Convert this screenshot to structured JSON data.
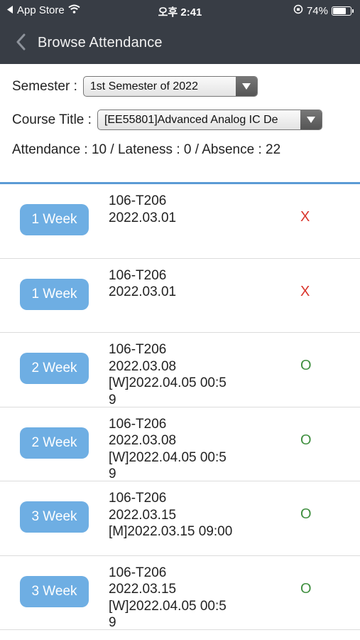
{
  "status_bar": {
    "back_app": "App Store",
    "time": "오후 2:41",
    "battery": "74%",
    "battery_level": 0.74
  },
  "nav": {
    "title": "Browse Attendance"
  },
  "filters": {
    "semester_label": "Semester :",
    "semester_value": "1st Semester of 2022",
    "course_label": "Course Title :",
    "course_value": "[EE55801]Advanced Analog IC De"
  },
  "summary": "Attendance : 10 / Lateness : 0 / Absence : 22",
  "records": [
    {
      "week": "1 Week",
      "room": "106-T206",
      "date": "2022.03.01",
      "detail_1": "",
      "detail_2": "",
      "mark": "X"
    },
    {
      "week": "1 Week",
      "room": "106-T206",
      "date": "2022.03.01",
      "detail_1": "",
      "detail_2": "",
      "mark": "X"
    },
    {
      "week": "2 Week",
      "room": "106-T206",
      "date": "2022.03.08",
      "detail_1": "[W]2022.04.05 00:5",
      "detail_2": "9",
      "mark": "O"
    },
    {
      "week": "2 Week",
      "room": "106-T206",
      "date": "2022.03.08",
      "detail_1": "[W]2022.04.05 00:5",
      "detail_2": "9",
      "mark": "O"
    },
    {
      "week": "3 Week",
      "room": "106-T206",
      "date": "2022.03.15",
      "detail_1": "[M]2022.03.15 09:00",
      "detail_2": "",
      "mark": "O"
    },
    {
      "week": "3 Week",
      "room": "106-T206",
      "date": "2022.03.15",
      "detail_1": "[W]2022.04.05 00:5",
      "detail_2": "9",
      "mark": "O"
    }
  ],
  "colors": {
    "header_bg": "#383d45",
    "week_button": "#6eaee3",
    "absent_mark": "#d9342b",
    "present_mark": "#3f8f3f",
    "list_divider_accent": "#5b9bd5"
  }
}
